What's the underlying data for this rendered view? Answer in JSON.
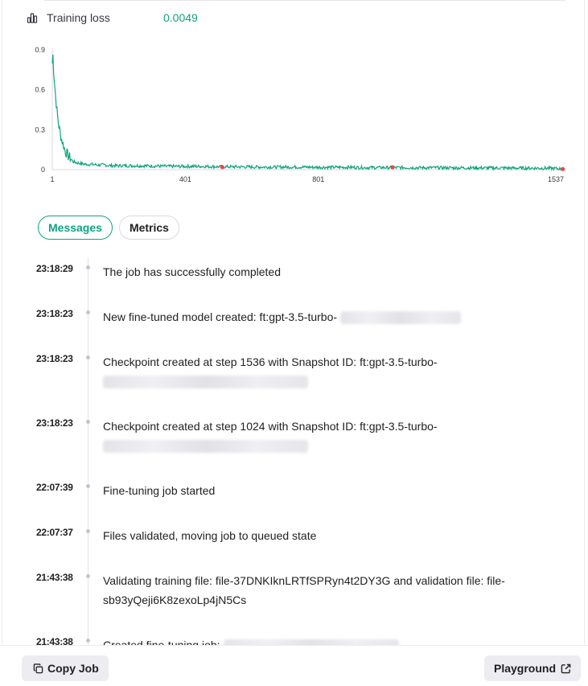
{
  "training_loss": {
    "label": "Training loss",
    "value": "0.0049",
    "icon": "bar-chart-icon",
    "value_color": "#10a37f"
  },
  "chart_data": {
    "type": "line",
    "title": "",
    "xlabel": "",
    "ylabel": "",
    "x_ticks": [
      "1",
      "401",
      "801",
      "1537"
    ],
    "y_ticks": [
      "0.9",
      "0.6",
      "0.3",
      "0"
    ],
    "xlim": [
      1,
      1537
    ],
    "ylim": [
      0,
      0.9
    ],
    "grid": false,
    "series": [
      {
        "color": "#10a37f",
        "x": [
          1,
          3,
          5,
          8,
          12,
          16,
          20,
          25,
          30,
          35,
          40,
          45,
          50,
          55,
          60,
          65,
          70,
          80,
          90,
          100,
          120,
          140,
          160,
          180,
          200,
          250,
          300,
          350,
          400,
          450,
          500,
          550,
          600,
          650,
          700,
          750,
          800,
          850,
          900,
          950,
          1000,
          1050,
          1100,
          1150,
          1200,
          1250,
          1300,
          1350,
          1400,
          1450,
          1500,
          1537
        ],
        "y": [
          0.8,
          0.86,
          0.75,
          0.65,
          0.52,
          0.42,
          0.34,
          0.27,
          0.22,
          0.18,
          0.14,
          0.12,
          0.1,
          0.09,
          0.07,
          0.06,
          0.055,
          0.05,
          0.045,
          0.04,
          0.04,
          0.035,
          0.035,
          0.03,
          0.03,
          0.03,
          0.028,
          0.025,
          0.025,
          0.025,
          0.022,
          0.022,
          0.02,
          0.02,
          0.02,
          0.02,
          0.018,
          0.018,
          0.018,
          0.016,
          0.016,
          0.016,
          0.015,
          0.015,
          0.014,
          0.014,
          0.013,
          0.013,
          0.012,
          0.012,
          0.011,
          0.0049
        ]
      }
    ],
    "checkpoints": {
      "color": "#ef4444",
      "x": [
        512,
        1024,
        1536
      ],
      "y": [
        0.02,
        0.018,
        0.0049
      ]
    }
  },
  "tabs": [
    {
      "label": "Messages",
      "active": true
    },
    {
      "label": "Metrics",
      "active": false
    }
  ],
  "events": [
    {
      "time": "23:18:29",
      "message": "The job has successfully completed"
    },
    {
      "time": "23:18:23",
      "message": "New fine-tuned model created: ft:gpt-3.5-turbo-"
    },
    {
      "time": "23:18:23",
      "message": "Checkpoint created at step 1536 with Snapshot ID: ft:gpt-3.5-turbo-"
    },
    {
      "time": "23:18:23",
      "message": "Checkpoint created at step 1024 with Snapshot ID: ft:gpt-3.5-turbo-"
    },
    {
      "time": "22:07:39",
      "message": "Fine-tuning job started"
    },
    {
      "time": "22:07:37",
      "message": "Files validated, moving job to queued state"
    },
    {
      "time": "21:43:38",
      "message": "Validating training file: file-37DNKIknLRTfSPRyn4t2DY3G and validation file: file-sb93yQeji6K8zexoLp4jN5Cs"
    },
    {
      "time": "21:43:38",
      "message": "Created fine-tuning job:"
    }
  ],
  "footer": {
    "copy_label": "Copy Job",
    "copy_icon": "copy-icon",
    "playground_label": "Playground",
    "playground_icon": "external-link-icon"
  }
}
